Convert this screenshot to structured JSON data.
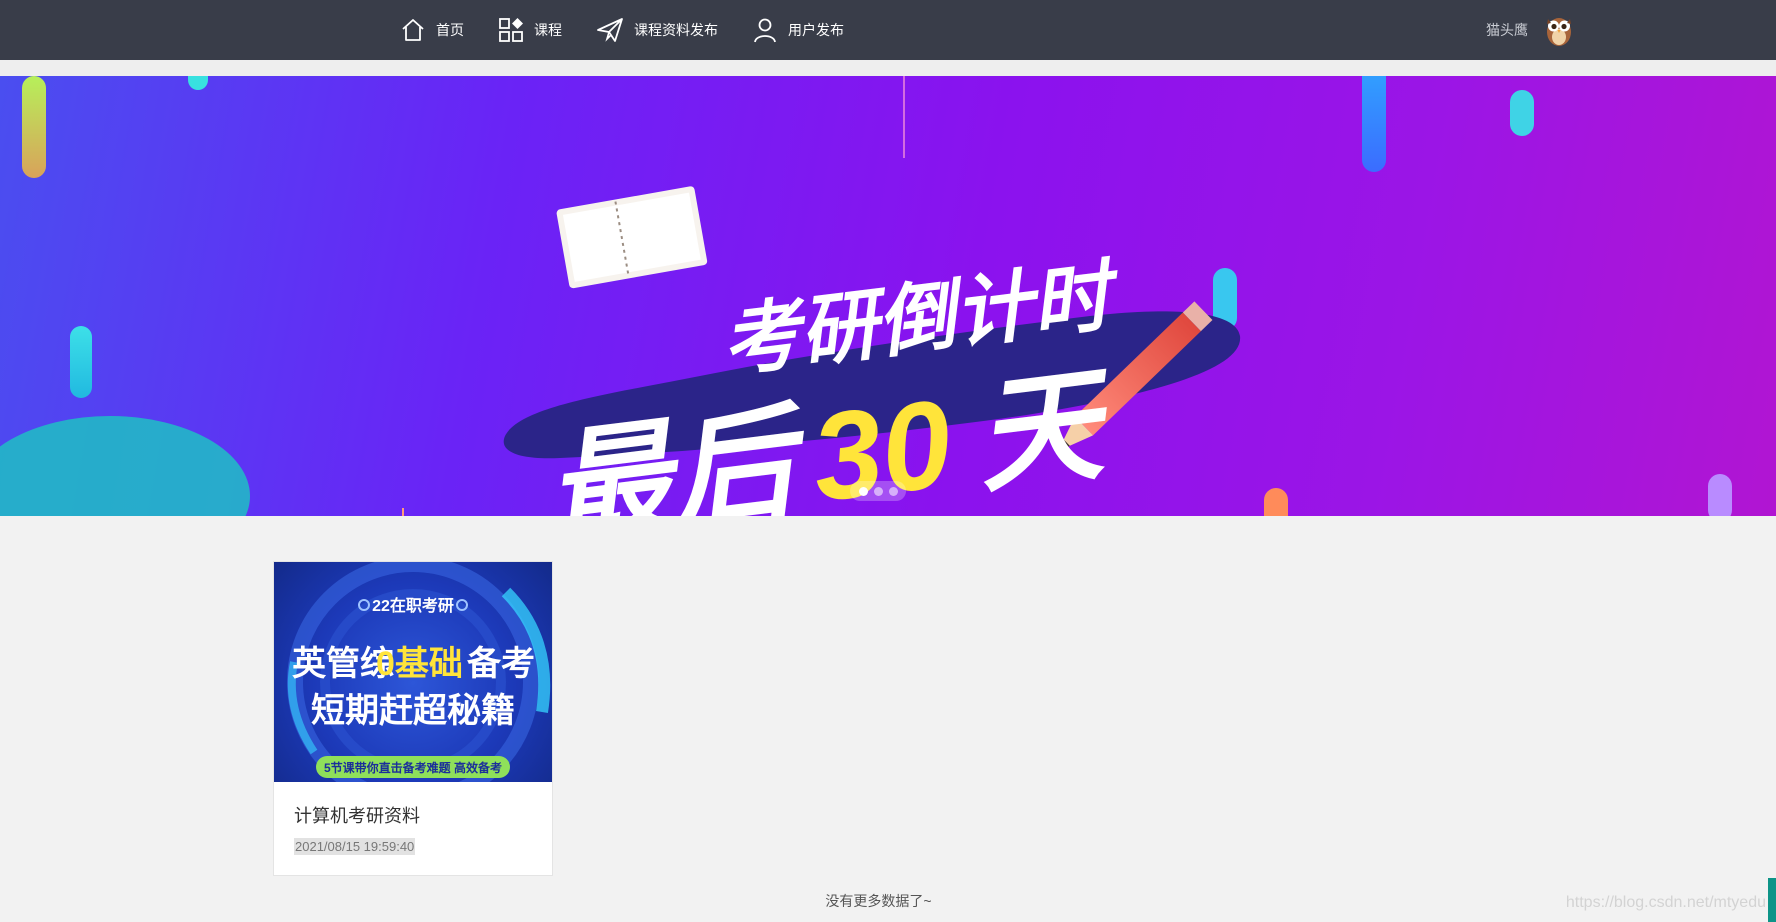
{
  "header": {
    "nav": [
      {
        "label": "首页",
        "icon": "home-icon"
      },
      {
        "label": "课程",
        "icon": "grid-icon"
      },
      {
        "label": "课程资料发布",
        "icon": "paper-plane-icon"
      },
      {
        "label": "用户发布",
        "icon": "user-icon"
      }
    ],
    "username": "猫头鹰",
    "avatar_icon": "owl-avatar"
  },
  "banner": {
    "line1": "考研倒计时",
    "line2a": "最后",
    "line2b": "30",
    "line2c": "天",
    "slides_total": 3,
    "active_slide": 1
  },
  "courses": [
    {
      "cover": {
        "badge": "22在职考研",
        "line1a": "英管综",
        "line1b": "0基础",
        "line1c": "备考",
        "line2": "短期赶超秘籍",
        "strip": "5节课带你直击备考难题  高效备考"
      },
      "title": "计算机考研资料",
      "time": "2021/08/15 19:59:40"
    }
  ],
  "footer": {
    "no_more": "没有更多数据了~",
    "watermark": "https://blog.csdn.net/mtyedu"
  },
  "colors": {
    "header_bg": "#393d49",
    "page_bg": "#f2f2f2",
    "banner_yellow": "#ffe43a",
    "side_tab": "#0d9488"
  }
}
